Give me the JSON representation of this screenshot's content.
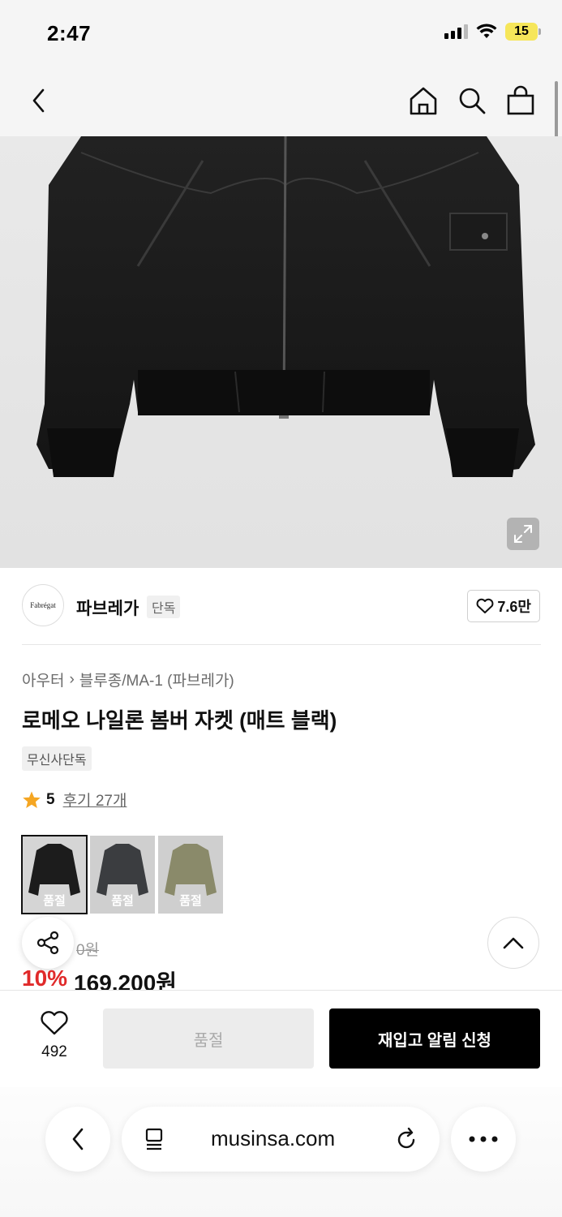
{
  "status_bar": {
    "time": "2:47",
    "battery": "15"
  },
  "product_image": {
    "alt": "jacket-photo"
  },
  "brand": {
    "logo_text": "Fabrégat",
    "name": "파브레가",
    "tag": "단독",
    "likes": "7.6만"
  },
  "breadcrumb": {
    "category": "아우터",
    "separator": "›",
    "subcategory": "블루종/MA-1 (파브레가)"
  },
  "product": {
    "title": "로메오 나일론 봄버 자켓 (매트 블랙)",
    "exclusive_badge": "무신사단독",
    "rating": "5",
    "review_link": "후기 27개"
  },
  "swatches": [
    {
      "label": "품절",
      "color": "#1c1c1c",
      "bg": "#d5d5d5"
    },
    {
      "label": "품절",
      "color": "#3b3d40",
      "bg": "#cfcfcf"
    },
    {
      "label": "품절",
      "color": "#8a8a6a",
      "bg": "#cfcfcf"
    }
  ],
  "price": {
    "original_visible": "0원",
    "discount": "10%",
    "current": "169,200원"
  },
  "buy_bar": {
    "wish_count": "492",
    "soldout_label": "품절",
    "restock_label": "재입고 알림 신청"
  },
  "safari": {
    "url": "musinsa.com"
  },
  "colors": {
    "accent_red": "#e02a2a",
    "star": "#f5a623"
  }
}
